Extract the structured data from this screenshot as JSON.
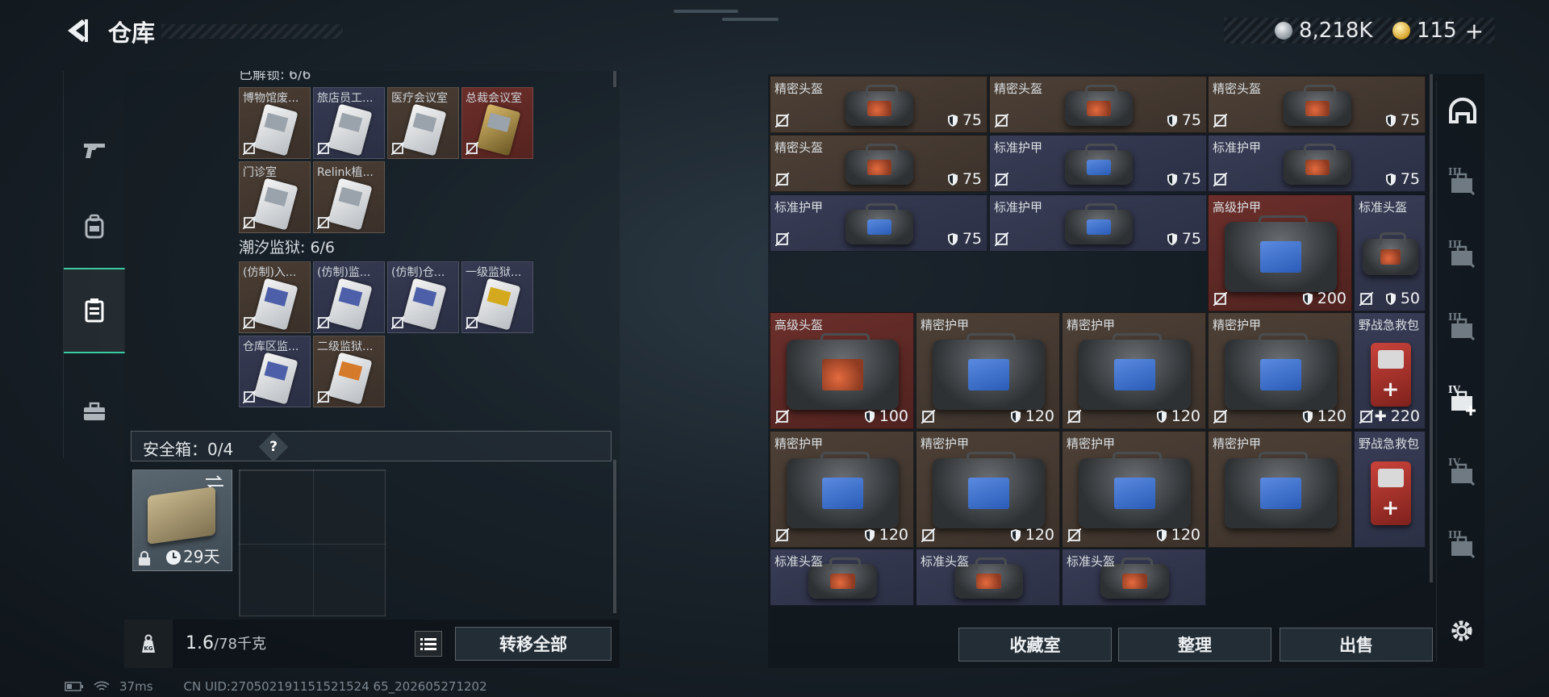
{
  "header": {
    "title": "仓库",
    "currency": {
      "coins": "8,218K",
      "premium": "115"
    }
  },
  "left_nav": {
    "items": [
      {
        "icon": "pistol-icon"
      },
      {
        "icon": "backpack-icon"
      },
      {
        "icon": "keycard-holder-icon",
        "active": true
      },
      {
        "icon": "toolbox-icon"
      }
    ]
  },
  "storage": {
    "partial_section_title": "已解锁: 6/6",
    "cards_top": [
      {
        "label": "博物馆废...",
        "bg": "brown",
        "tone": "plain"
      },
      {
        "label": "旅店员工...",
        "bg": "navy",
        "tone": "plain"
      },
      {
        "label": "医疗会议室",
        "bg": "brown",
        "tone": "plain"
      },
      {
        "label": "总裁会议室",
        "bg": "red",
        "tone": "gold"
      },
      {
        "label": "门诊室",
        "bg": "brown",
        "tone": "plain"
      },
      {
        "label": "Relink植...",
        "bg": "brown",
        "tone": "plain"
      }
    ],
    "section2": {
      "title": "潮汐监狱: 6/6"
    },
    "cards_bottom": [
      {
        "label": "(仿制)入...",
        "bg": "brown",
        "tone": "blue"
      },
      {
        "label": "(仿制)监...",
        "bg": "navy",
        "tone": "blue"
      },
      {
        "label": "(仿制)仓...",
        "bg": "navy",
        "tone": "blue"
      },
      {
        "label": "一级监狱...",
        "bg": "navy",
        "tone": "yellow"
      },
      {
        "label": "仓库区监...",
        "bg": "navy",
        "tone": "blue"
      },
      {
        "label": "二级监狱...",
        "bg": "brown",
        "tone": "orange"
      }
    ],
    "safebox": {
      "label": "安全箱：0/4",
      "help": "?",
      "remaining": "29天"
    },
    "weight": {
      "current": "1.6",
      "max": "/78千克"
    },
    "transfer_all": "转移全部"
  },
  "inventory": {
    "items": [
      {
        "name": "精密头盔",
        "durability": "75",
        "color": "brown",
        "type": "helmet"
      },
      {
        "name": "精密头盔",
        "durability": "75",
        "color": "brown",
        "type": "helmet"
      },
      {
        "name": "精密头盔",
        "durability": "75",
        "color": "brown",
        "type": "helmet"
      },
      {
        "name": "精密头盔",
        "durability": "75",
        "color": "brown",
        "type": "helmet"
      },
      {
        "name": "标准护甲",
        "durability": "75",
        "color": "navy",
        "type": "armor"
      },
      {
        "name": "标准护甲",
        "durability": "75",
        "color": "navy",
        "type": "helmet"
      },
      {
        "name": "标准护甲",
        "durability": "75",
        "color": "navy",
        "type": "armor"
      },
      {
        "name": "标准护甲",
        "durability": "75",
        "color": "navy",
        "type": "armor"
      },
      {
        "name": "高级护甲",
        "durability": "200",
        "color": "red",
        "type": "armor"
      },
      {
        "name": "标准头盔",
        "durability": "50",
        "color": "navy",
        "type": "helmet"
      },
      {
        "name": "高级头盔",
        "durability": "100",
        "color": "red",
        "type": "helmet"
      },
      {
        "name": "精密护甲",
        "durability": "120",
        "color": "brown",
        "type": "armor"
      },
      {
        "name": "精密护甲",
        "durability": "120",
        "color": "brown",
        "type": "armor"
      },
      {
        "name": "精密护甲",
        "durability": "120",
        "color": "brown",
        "type": "armor"
      },
      {
        "name": "野战急救包",
        "durability": "220",
        "color": "navy",
        "type": "medkit"
      },
      {
        "name": "精密护甲",
        "durability": "120",
        "color": "brown",
        "type": "armor"
      },
      {
        "name": "精密护甲",
        "durability": "120",
        "color": "brown",
        "type": "armor"
      },
      {
        "name": "精密护甲",
        "durability": "120",
        "color": "brown",
        "type": "armor"
      },
      {
        "name": "精密护甲",
        "durability": "",
        "color": "brown",
        "type": "armor"
      },
      {
        "name": "野战急救包",
        "durability": "",
        "color": "navy",
        "type": "medkit"
      },
      {
        "name": "标准头盔",
        "durability": "",
        "color": "navy",
        "type": "helmet"
      },
      {
        "name": "标准头盔",
        "durability": "",
        "color": "navy",
        "type": "helmet"
      },
      {
        "name": "标准头盔",
        "durability": "",
        "color": "navy",
        "type": "helmet"
      }
    ],
    "buttons": {
      "collection": "收藏室",
      "organize": "整理",
      "sell": "出售"
    }
  },
  "right_rail": {
    "items": [
      {
        "icon": "helmet-slot-icon",
        "level": ""
      },
      {
        "icon": "case-slot-icon",
        "level": "III"
      },
      {
        "icon": "case-slot-icon",
        "level": "III"
      },
      {
        "icon": "case-slot-icon",
        "level": "III"
      },
      {
        "icon": "case-add-icon",
        "level": "IV"
      },
      {
        "icon": "case-slot-icon",
        "level": "IV"
      },
      {
        "icon": "case-slot-icon",
        "level": "III"
      }
    ]
  },
  "footer": {
    "ping": "37ms",
    "uid": "CN UID:270502191151521524 65_202605271202"
  }
}
